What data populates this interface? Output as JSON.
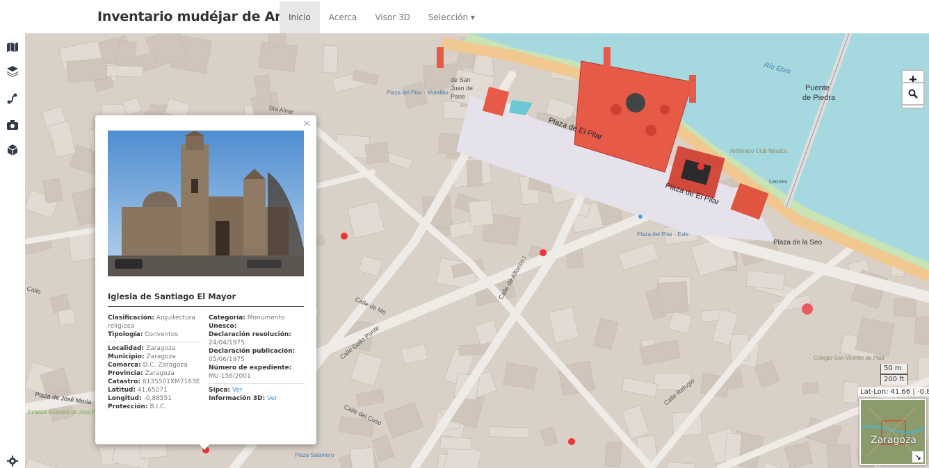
{
  "app": {
    "brand": "Inventario mudéjar de Aragón",
    "nav": [
      {
        "label": "Inicio",
        "active": true
      },
      {
        "label": "Acerca",
        "active": false
      },
      {
        "label": "Visor 3D",
        "active": false
      },
      {
        "label": "Selección ▾",
        "active": false
      }
    ]
  },
  "sidebar": {
    "icons": [
      "map-icon",
      "layers-icon",
      "route-icon",
      "camera-icon",
      "cube-icon",
      "settings-icon"
    ]
  },
  "map": {
    "zoom_in": "+",
    "zoom_out": "−",
    "scale_metric": "50 m",
    "scale_imperial": "200 ft",
    "latlon": "Lat-Lon: 41.66 | -0.88",
    "minimap_city": "Zaragoza",
    "minimap_toggle": "↘",
    "labels": [
      {
        "text": "Río Ebro"
      },
      {
        "text": "Puente"
      },
      {
        "text": "de Piedra"
      },
      {
        "text": "Plaza de El Pilar"
      },
      {
        "text": "Plaza de El Pilar"
      },
      {
        "text": "Plaza del Pilar - Murallas"
      },
      {
        "text": "de San"
      },
      {
        "text": "Juan de"
      },
      {
        "text": "Pane"
      },
      {
        "text": "Calle de Alfonso I"
      },
      {
        "text": "Calle Gallo Ponte"
      },
      {
        "text": "Calle del Coso"
      },
      {
        "text": "Calle de Mo"
      },
      {
        "text": "Plaza de José Maria"
      },
      {
        "text": "Estatua ecuestre de José Palafox"
      },
      {
        "text": "Plaza de la Seo"
      },
      {
        "text": "Colegio San Vicente de Paúl"
      },
      {
        "text": "Calle Refugio"
      },
      {
        "text": "Anfiteatro Club Náutico"
      },
      {
        "text": "Plaza del Pilar - Este"
      },
      {
        "text": "Plaza Salamero"
      },
      {
        "text": "Sta Alvar"
      },
      {
        "text": "Calle"
      },
      {
        "text": "Leones"
      }
    ]
  },
  "popup": {
    "close": "×",
    "title": "Iglesia de Santiago El Mayor",
    "left": [
      {
        "label": "Clasificación:",
        "value": "Arquitectura religiosa"
      },
      {
        "label": "Tipología:",
        "value": "Conventos"
      },
      {
        "sep": true
      },
      {
        "label": "Localidad:",
        "value": "Zaragoza"
      },
      {
        "label": "Municipio:",
        "value": "Zaragoza"
      },
      {
        "label": "Comarca:",
        "value": "D.C. Zaragoza"
      },
      {
        "label": "Provincia:",
        "value": "Zaragoza"
      },
      {
        "label": "Catastro:",
        "value": "6135501XM7163E"
      },
      {
        "label": "Latitud:",
        "value": "41,65271"
      },
      {
        "label": "Longitud:",
        "value": "-0,88551"
      },
      {
        "label": "Protección:",
        "value": "B.I.C."
      }
    ],
    "right": [
      {
        "label": "Categoría:",
        "value": "Monumento"
      },
      {
        "label": "Unesco:",
        "value": ""
      },
      {
        "label": "Declaración resolución:",
        "value": "24/04/1975"
      },
      {
        "label": "Declaración publicación:",
        "value": "05/06/1975"
      },
      {
        "label": "Número de expediente:",
        "value": "MU-156/2001"
      },
      {
        "sep": true
      },
      {
        "label": "Sipca:",
        "value": "Ver",
        "link": true
      },
      {
        "label": "Información 3D:",
        "value": "Ver",
        "link": true
      }
    ]
  },
  "colors": {
    "river": "#a6d9df",
    "basilica": "#e85a48",
    "building": "#d6ccc2",
    "street": "#ece8e4",
    "accent": "#3a8fd6"
  }
}
